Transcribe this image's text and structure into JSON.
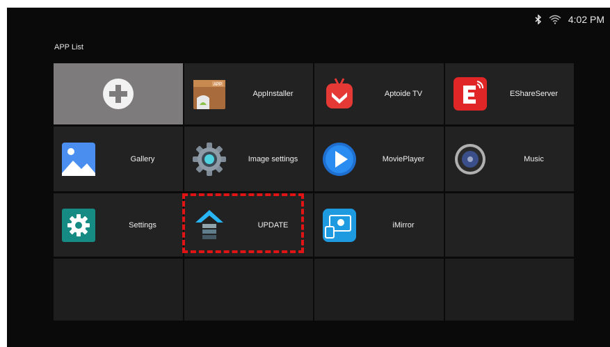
{
  "status": {
    "time": "4:02 PM"
  },
  "page": {
    "title": "APP List"
  },
  "apps": [
    {
      "label": "AppInstaller",
      "icon": "appinstaller-icon"
    },
    {
      "label": "Aptoide TV",
      "icon": "aptoide-icon"
    },
    {
      "label": "EShareServer",
      "icon": "eshare-icon"
    },
    {
      "label": "Gallery",
      "icon": "gallery-icon"
    },
    {
      "label": "Image settings",
      "icon": "image-settings-icon"
    },
    {
      "label": "MoviePlayer",
      "icon": "movieplayer-icon"
    },
    {
      "label": "Music",
      "icon": "music-icon"
    },
    {
      "label": "Settings",
      "icon": "settings-icon"
    },
    {
      "label": "UPDATE",
      "icon": "update-icon"
    },
    {
      "label": "iMirror",
      "icon": "imirror-icon"
    }
  ],
  "colors": {
    "background": "#0a0a0a",
    "tile": "#222222",
    "add_tile": "#7d7b7b",
    "focus": "#e01414"
  }
}
